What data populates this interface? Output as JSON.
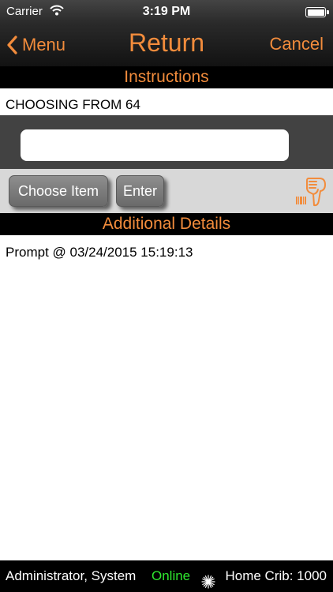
{
  "status_bar": {
    "carrier": "Carrier",
    "time": "3:19 PM"
  },
  "nav": {
    "back_label": "Menu",
    "title": "Return",
    "cancel_label": "Cancel"
  },
  "instructions": {
    "header": "Instructions",
    "text": "CHOOSING FROM 64"
  },
  "input": {
    "value": "",
    "placeholder": ""
  },
  "buttons": {
    "choose_item": "Choose Item",
    "enter": "Enter"
  },
  "details": {
    "header": "Additional Details",
    "lines": [
      "Prompt @ 03/24/2015 15:19:13"
    ]
  },
  "footer": {
    "user": "Administrator, System",
    "connection": "Online",
    "location": "Home Crib: 1000"
  },
  "colors": {
    "accent": "#f28c3c",
    "online": "#2ee62e",
    "bar_background": "#000000"
  },
  "icons": {
    "back": "chevron-left-icon",
    "wifi": "wifi-icon",
    "battery": "battery-icon",
    "scanner": "barcode-scanner-icon",
    "sync": "sparkle-icon"
  }
}
